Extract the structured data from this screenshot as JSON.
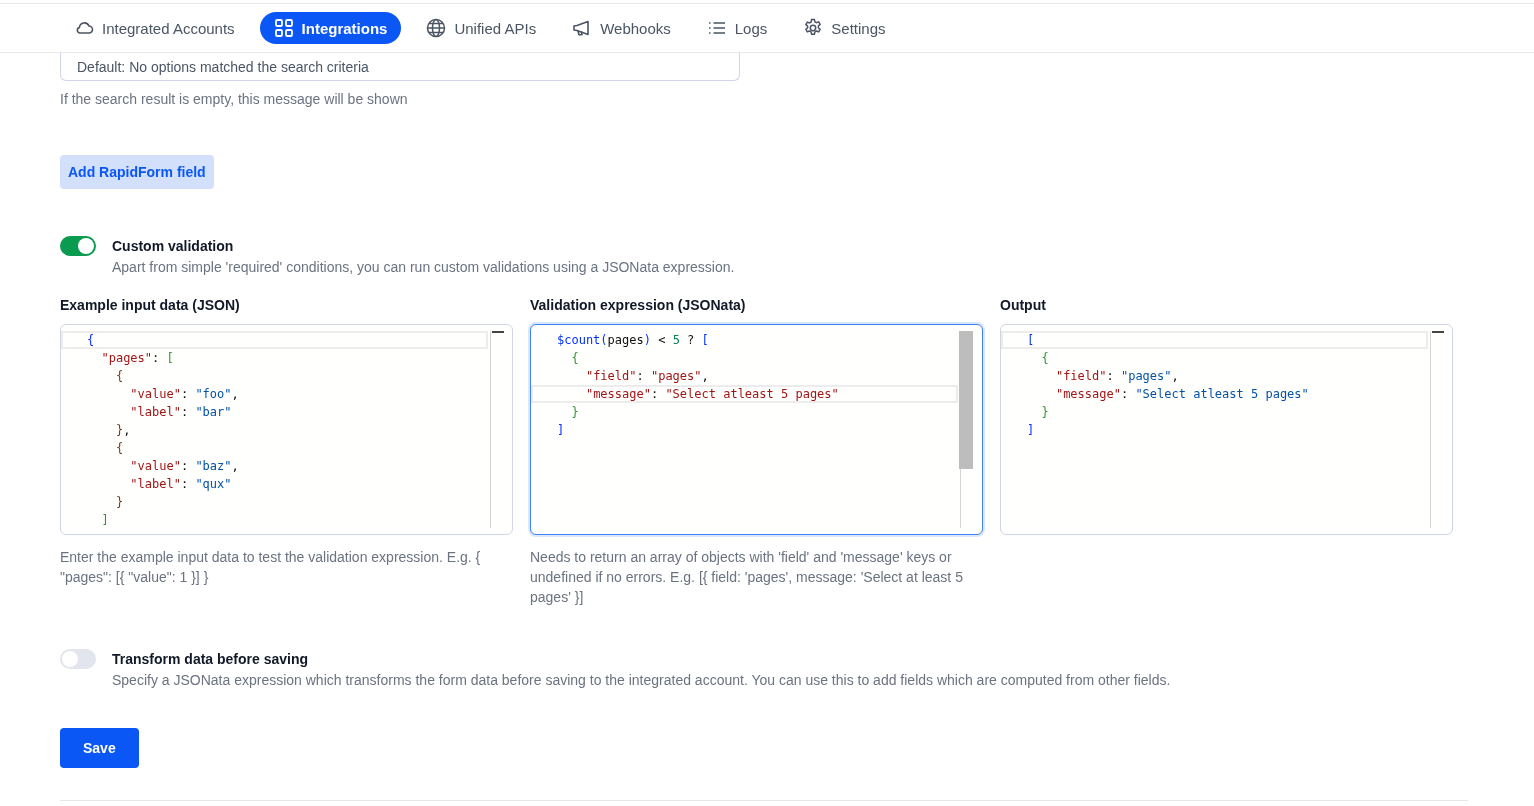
{
  "nav": {
    "tabs": [
      {
        "label": "Integrated Accounts",
        "selected": false
      },
      {
        "label": "Integrations",
        "selected": true
      },
      {
        "label": "Unified APIs",
        "selected": false
      },
      {
        "label": "Webhooks",
        "selected": false
      },
      {
        "label": "Logs",
        "selected": false
      },
      {
        "label": "Settings",
        "selected": false
      }
    ]
  },
  "default_field": {
    "value": "Default: No options matched the search criteria",
    "help": "If the search result is empty, this message will be shown"
  },
  "add_button": "Add RapidForm field",
  "custom_validation": {
    "label": "Custom validation",
    "description": "Apart from simple 'required' conditions, you can run custom validations using a JSONata expression.",
    "on": true
  },
  "editors": [
    {
      "title": "Example input data (JSON)",
      "kind": "json",
      "focused": false,
      "help": "Enter the example input data to test the validation expression. E.g. { \"pages\": [{ \"value\": 1 }] }",
      "lines": [
        {
          "text": "{",
          "current": true
        },
        {
          "text": "  \"pages\": [",
          "current": false
        },
        {
          "text": "    {",
          "current": false
        },
        {
          "text": "      \"value\": \"foo\",",
          "current": false
        },
        {
          "text": "      \"label\": \"bar\"",
          "current": false
        },
        {
          "text": "    },",
          "current": false
        },
        {
          "text": "    {",
          "current": false
        },
        {
          "text": "      \"value\": \"baz\",",
          "current": false
        },
        {
          "text": "      \"label\": \"qux\"",
          "current": false
        },
        {
          "text": "    }",
          "current": false
        },
        {
          "text": "  ]",
          "current": false
        }
      ]
    },
    {
      "title": "Validation expression (JSONata)",
      "kind": "jsonata",
      "focused": true,
      "help": "Needs to return an array of objects with 'field' and 'message' keys or undefined if no errors. E.g. [{ field: 'pages', message: 'Select at least 5 pages' }]",
      "lines": [
        {
          "text": "$count(pages) < 5 ? [",
          "current": false
        },
        {
          "text": "  {",
          "current": false
        },
        {
          "text": "    \"field\": \"pages\",",
          "current": false
        },
        {
          "text": "    \"message\": \"Select atleast 5 pages\"",
          "current": true
        },
        {
          "text": "  }",
          "current": false
        },
        {
          "text": "]",
          "current": false
        }
      ]
    },
    {
      "title": "Output",
      "kind": "json",
      "focused": false,
      "lines": [
        {
          "text": "[",
          "current": true
        },
        {
          "text": "  {",
          "current": false
        },
        {
          "text": "    \"field\": \"pages\",",
          "current": false
        },
        {
          "text": "    \"message\": \"Select atleast 5 pages\"",
          "current": false
        },
        {
          "text": "  }",
          "current": false
        },
        {
          "text": "]",
          "current": false
        }
      ]
    }
  ],
  "transform": {
    "label": "Transform data before saving",
    "description": "Specify a JSONata expression which transforms the form data before saving to the integrated account. You can use this to add fields which are computed from other fields.",
    "on": false
  },
  "save_button": "Save"
}
